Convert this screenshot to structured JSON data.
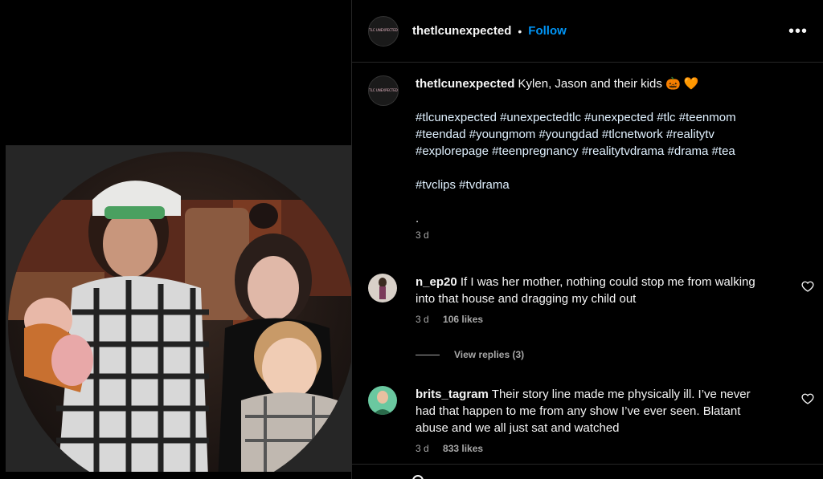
{
  "post": {
    "username": "thetlcunexpected",
    "separator": "•",
    "follow_label": "Follow",
    "more_label": "•••",
    "avatar_text": "TLC UNEXPECTED"
  },
  "caption": {
    "username": "thetlcunexpected",
    "text": "Kylen, Jason and their kids 🎃 🧡",
    "hashtags_1": "#tlcunexpected #unexpectedtlc #unexpected #tlc #teenmom",
    "hashtags_2": "#teendad #youngmom #youngdad #tlcnetwork #realitytv",
    "hashtags_3": "#explorepage #teenpregnancy #realitytvdrama #drama #tea",
    "hashtags_4": "#tvclips #tvdrama",
    "dot": ".",
    "time": "3 d"
  },
  "comments": [
    {
      "username": "n_ep20",
      "text": "If I was her mother, nothing could stop me from walking into that house and dragging my child out",
      "time": "3 d",
      "likes": "106 likes",
      "view_replies": "View replies (3)"
    },
    {
      "username": "brits_tagram",
      "text": "Their story line made me physically ill. I’ve never had that happen to me from any show I’ve ever seen. Blatant abuse and we all just sat and watched",
      "time": "3 d",
      "likes": "833 likes"
    }
  ],
  "icons": {
    "more": "more-options-icon",
    "heart": "heart-icon",
    "avatar": "avatar"
  }
}
